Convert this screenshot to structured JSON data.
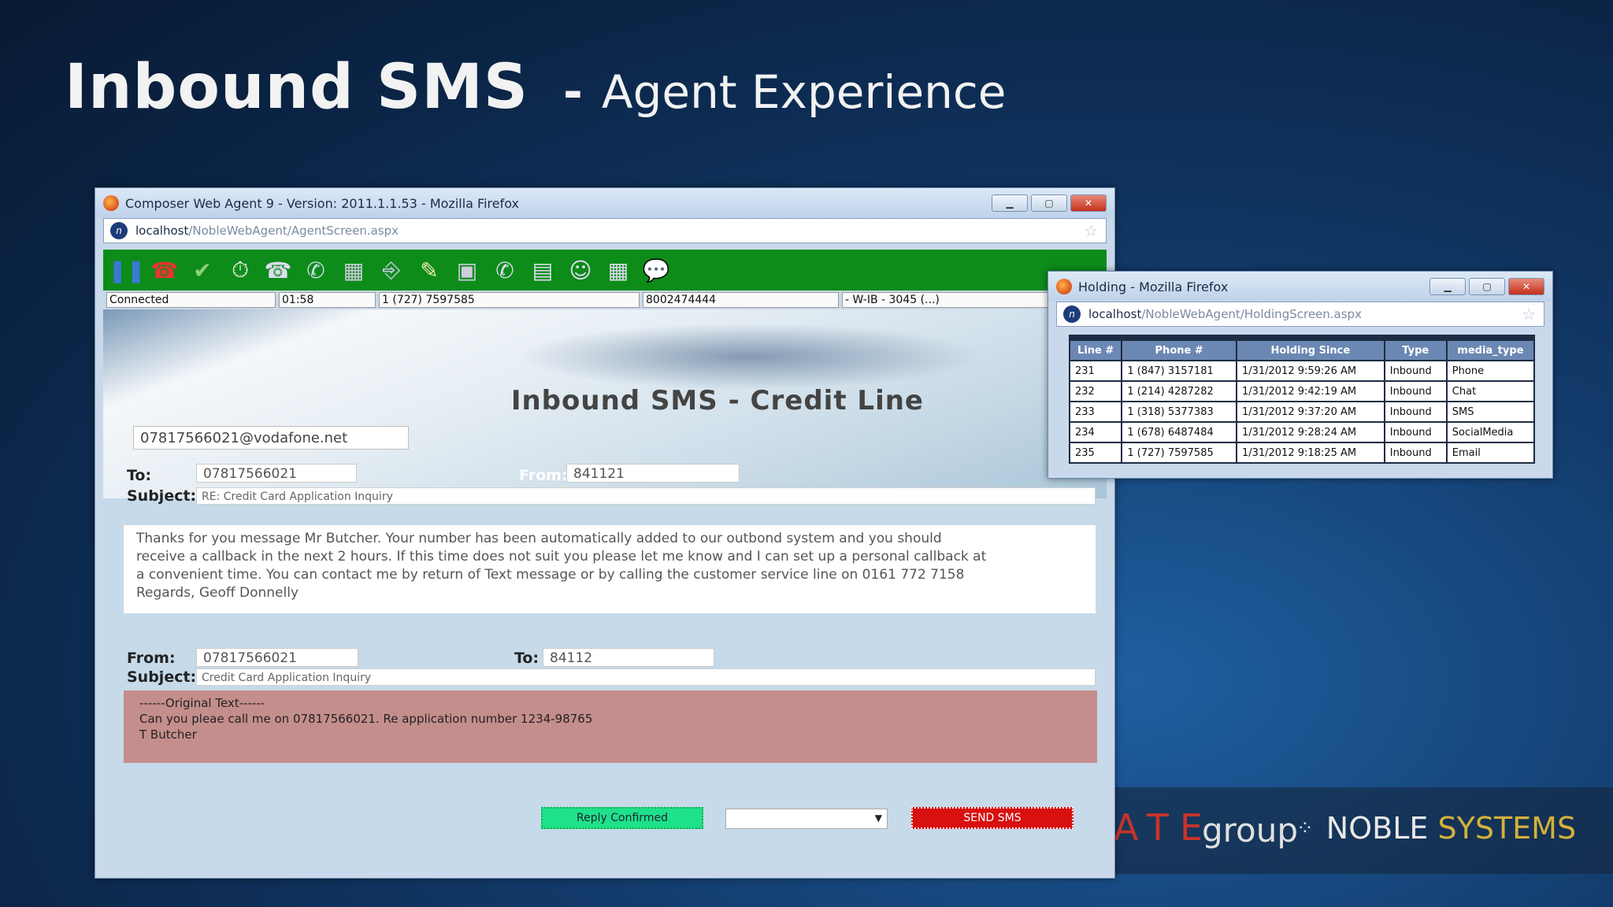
{
  "slide": {
    "title_main": "Inbound SMS",
    "title_dash": "-",
    "title_sub": "Agent Experience"
  },
  "agent_window": {
    "title": "Composer Web Agent 9 - Version: 2011.1.1.53 - Mozilla Firefox",
    "url_host": "localhost",
    "url_path": "/NobleWebAgent/AgentScreen.aspx",
    "status": {
      "state": "Connected",
      "timer": "01:58",
      "phone": "1 (727) 7597585",
      "number": "8002474444",
      "campaign": "- W-IB - 3045 (...)"
    },
    "banner_title": "Inbound SMS - Credit Line",
    "email": "07817566021@vodafone.net",
    "incoming": {
      "to_label": "To:",
      "to_value": "07817566021",
      "from_label": "From:",
      "from_value": "841121",
      "subject_label": "Subject:",
      "subject_value": "RE: Credit Card Application Inquiry",
      "message_lines": [
        "Thanks for you message Mr Butcher. Your number has been automatically added to our outbond system and you should",
        "receive a callback in the next 2 hours. If this time does not suit you please let me know and I can set up a personal callback at",
        "a convenient time. You can contact me by return of Text message or by calling the customer service line on 0161 772 7158",
        "Regards, Geoff Donnelly"
      ]
    },
    "reply": {
      "from_label": "From:",
      "from_value": "07817566021",
      "to_label": "To:",
      "to_value": "84112",
      "subject_label": "Subject:",
      "subject_value": "Credit Card Application Inquiry",
      "original_lines": [
        "------Original Text------",
        "Can you pleae call me on 07817566021. Re application number 1234-98765",
        "T Butcher"
      ]
    },
    "buttons": {
      "reply_confirmed": "Reply Confirmed",
      "send_sms": "SEND SMS"
    }
  },
  "holding_window": {
    "title": "Holding - Mozilla Firefox",
    "url_host": "localhost",
    "url_path": "/NobleWebAgent/HoldingScreen.aspx",
    "columns": [
      "Line #",
      "Phone #",
      "Holding Since",
      "Type",
      "media_type"
    ],
    "rows": [
      [
        "231",
        "1 (847) 3157181",
        "1/31/2012 9:59:26 AM",
        "Inbound",
        "Phone"
      ],
      [
        "232",
        "1 (214) 4287282",
        "1/31/2012 9:42:19 AM",
        "Inbound",
        "Chat"
      ],
      [
        "233",
        "1 (318) 5377383",
        "1/31/2012 9:37:20 AM",
        "Inbound",
        "SMS"
      ],
      [
        "234",
        "1 (678) 6487484",
        "1/31/2012 9:28:24 AM",
        "Inbound",
        "SocialMedia"
      ],
      [
        "235",
        "1 (727) 7597585",
        "1/31/2012 9:18:25 AM",
        "Inbound",
        "Email"
      ]
    ]
  },
  "logos": {
    "ate": "ATE",
    "group": "group",
    "noble": "NOBLE",
    "systems": "SYSTEMS"
  },
  "colors": {
    "toolbar_green": "#0d8c1a",
    "reply_button": "#1de28a",
    "send_button": "#d8100f",
    "original_text_bg": "#c48e8c"
  }
}
